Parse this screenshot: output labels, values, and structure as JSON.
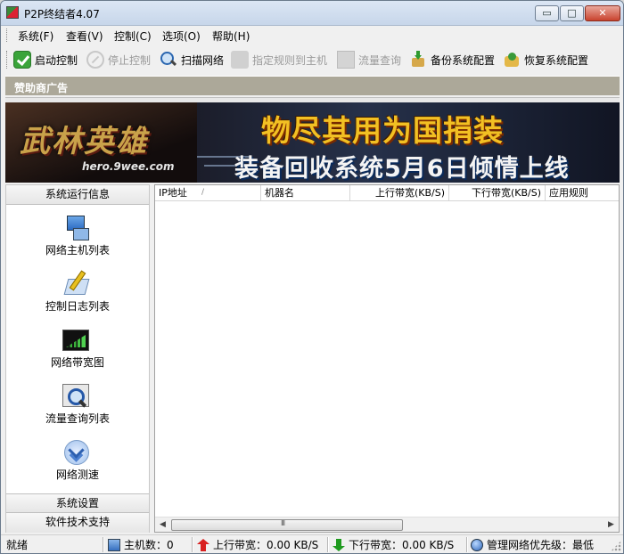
{
  "window": {
    "title": "P2P终结者4.07",
    "buttons": {
      "minimize": "▭",
      "maximize": "□",
      "close": "✕"
    }
  },
  "menu": {
    "items": [
      {
        "label": "系统(F)"
      },
      {
        "label": "查看(V)"
      },
      {
        "label": "控制(C)"
      },
      {
        "label": "选项(O)"
      },
      {
        "label": "帮助(H)"
      }
    ]
  },
  "toolbar": {
    "start_control": {
      "label": "启动控制",
      "icon": "check-icon",
      "enabled": true
    },
    "stop_control": {
      "label": "停止控制",
      "icon": "stop-icon",
      "enabled": false
    },
    "scan_network": {
      "label": "扫描网络",
      "icon": "magnifier-icon",
      "enabled": true
    },
    "assign_rule": {
      "label": "指定规则到主机",
      "icon": "rule-icon",
      "enabled": false
    },
    "traffic_query": {
      "label": "流量查询",
      "icon": "query-icon",
      "enabled": false
    },
    "backup_config": {
      "label": "备份系统配置",
      "icon": "backup-icon",
      "enabled": true
    },
    "restore_config": {
      "label": "恢复系统配置",
      "icon": "restore-icon",
      "enabled": true
    }
  },
  "sponsor": {
    "label": "赞助商广告",
    "banner": {
      "logo": "武林英雄",
      "url": "hero.9wee.com",
      "line1": "物尽其用为国捐装",
      "line2": "装备回收系统5月6日倾情上线"
    }
  },
  "left_panel": {
    "top_header": "系统运行信息",
    "items": [
      {
        "label": "网络主机列表",
        "icon": "hosts-icon"
      },
      {
        "label": "控制日志列表",
        "icon": "log-icon"
      },
      {
        "label": "网络带宽图",
        "icon": "bandwidth-chart-icon"
      },
      {
        "label": "流量查询列表",
        "icon": "traffic-query-icon"
      },
      {
        "label": "网络测速",
        "icon": "speed-test-icon"
      }
    ],
    "scroll_arrow": "▼",
    "bottom_headers": [
      "系统设置",
      "软件技术支持"
    ]
  },
  "host_table": {
    "columns": [
      "IP地址",
      "机器名",
      "上行带宽(KB/S)",
      "下行带宽(KB/S)",
      "应用规则"
    ],
    "sort_indicator": "/",
    "rows": [],
    "scroll": {
      "left": "◀",
      "right": "▶"
    }
  },
  "statusbar": {
    "status": "就绪",
    "host_count": "主机数：0",
    "upload": "上行带宽：0.00 KB/S",
    "download": "下行带宽：0.00 KB/S",
    "priority": "管理网络优先级：最低"
  }
}
